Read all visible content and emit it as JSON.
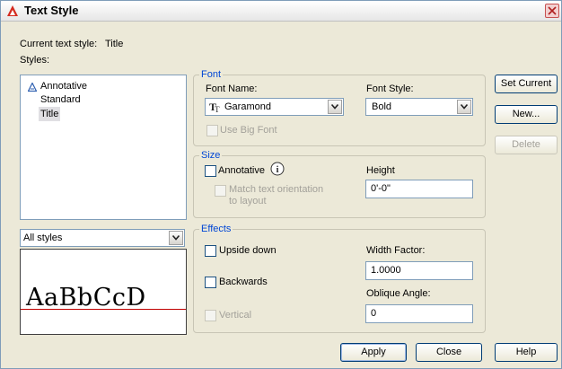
{
  "window": {
    "title": "Text Style",
    "close_icon": "close-icon"
  },
  "current_style": {
    "label": "Current text style:",
    "value": "Title"
  },
  "styles": {
    "label": "Styles:",
    "items": [
      {
        "label": "Annotative",
        "icon": "annotative-icon",
        "selected": false
      },
      {
        "label": "Standard",
        "selected": false
      },
      {
        "label": "Title",
        "selected": true
      }
    ],
    "filter": {
      "value": "All styles"
    }
  },
  "preview": {
    "text": "AaBbCcD",
    "baseline_color": "#c00000"
  },
  "font": {
    "legend": "Font",
    "font_name_label": "Font Name:",
    "font_name_value": "Garamond",
    "font_name_icon": "truetype-icon",
    "font_style_label": "Font Style:",
    "font_style_value": "Bold",
    "use_big_font_label": "Use Big Font"
  },
  "size": {
    "legend": "Size",
    "annotative_label": "Annotative",
    "info_icon": "info-icon",
    "match_orientation_label": "Match text orientation",
    "match_orientation_label2": "to layout",
    "height_label": "Height",
    "height_value": "0'-0\""
  },
  "effects": {
    "legend": "Effects",
    "upside_down_label": "Upside down",
    "backwards_label": "Backwards",
    "vertical_label": "Vertical",
    "width_factor_label": "Width Factor:",
    "width_factor_value": "1.0000",
    "oblique_label": "Oblique Angle:",
    "oblique_value": "0"
  },
  "buttons": {
    "set_current": "Set Current",
    "new": "New...",
    "delete": "Delete",
    "apply": "Apply",
    "close": "Close",
    "help": "Help"
  },
  "colors": {
    "legend": "#0046d5",
    "title_icon": "#d42a1e",
    "disabled": "#a3a19a"
  }
}
